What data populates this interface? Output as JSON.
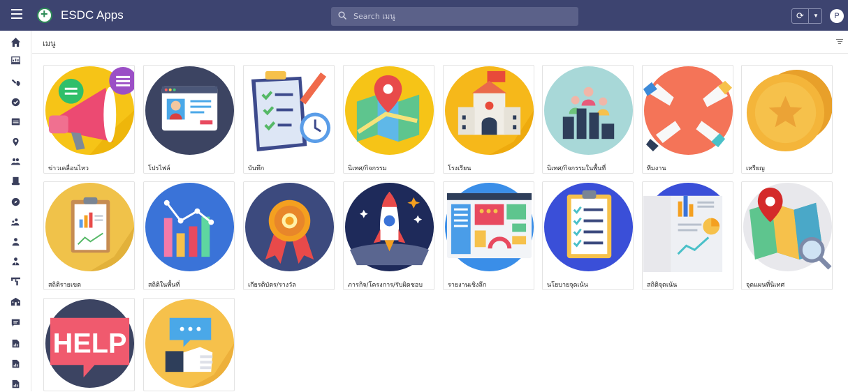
{
  "app": {
    "title": "ESDC Apps"
  },
  "search": {
    "placeholder": "Search เมนู"
  },
  "user": {
    "avatar_letter": "P"
  },
  "subheader": {
    "title": "เมนู"
  },
  "tiles": [
    {
      "label": "ข่าวเคลื่อนไหว",
      "icon": "megaphone-icon"
    },
    {
      "label": "โปรไฟล์",
      "icon": "profile-card-icon"
    },
    {
      "label": "บันทึก",
      "icon": "checklist-clipboard-icon"
    },
    {
      "label": "นิเทศ/กิจกรรม",
      "icon": "map-pin-icon"
    },
    {
      "label": "โรงเรียน",
      "icon": "school-building-icon"
    },
    {
      "label": "นิเทศ/กิจกรรมในพื้นที่",
      "icon": "people-chart-icon"
    },
    {
      "label": "ทีมงาน",
      "icon": "team-hands-icon"
    },
    {
      "label": "เหรียญ",
      "icon": "coin-star-icon"
    },
    {
      "label": "สถิติรายเขต",
      "icon": "statistics-board-icon"
    },
    {
      "label": "สถิติในพื้นที่",
      "icon": "bar-line-chart-icon"
    },
    {
      "label": "เกียรติบัตร/รางวัล",
      "icon": "award-medal-icon"
    },
    {
      "label": "ภารกิจ/โครงการ/รับผิดชอบ",
      "icon": "rocket-icon"
    },
    {
      "label": "รายงานเชิงลึก",
      "icon": "dashboard-report-icon"
    },
    {
      "label": "นโยบายจุดเน้น",
      "icon": "policy-checklist-icon"
    },
    {
      "label": "สถิติจุดเน้น",
      "icon": "report-document-icon"
    },
    {
      "label": "จุดแผนที่นิเทศ",
      "icon": "map-search-icon"
    },
    {
      "label": "",
      "icon": "help-sign-icon"
    },
    {
      "label": "",
      "icon": "feedback-thumbs-up-icon"
    }
  ],
  "sidebar": {
    "items": [
      {
        "icon": "home-icon"
      },
      {
        "icon": "dashboard-icon"
      },
      {
        "icon": "tools-icon"
      },
      {
        "icon": "check-circle-icon"
      },
      {
        "icon": "calendar-icon"
      },
      {
        "icon": "location-pin-icon"
      },
      {
        "icon": "users-icon"
      },
      {
        "icon": "scroll-icon"
      },
      {
        "icon": "compass-icon"
      },
      {
        "icon": "user-group-icon"
      },
      {
        "icon": "user-icon"
      },
      {
        "icon": "user-tie-icon"
      },
      {
        "icon": "sitemap-icon"
      },
      {
        "icon": "school-icon"
      },
      {
        "icon": "message-icon"
      },
      {
        "icon": "file-chart-icon"
      },
      {
        "icon": "file-chart-icon"
      },
      {
        "icon": "file-chart-icon"
      }
    ]
  },
  "colors": {
    "topbar": "#3d4470",
    "sidebar_icon": "#3a3f5c",
    "search_bg": "#5b6189"
  }
}
